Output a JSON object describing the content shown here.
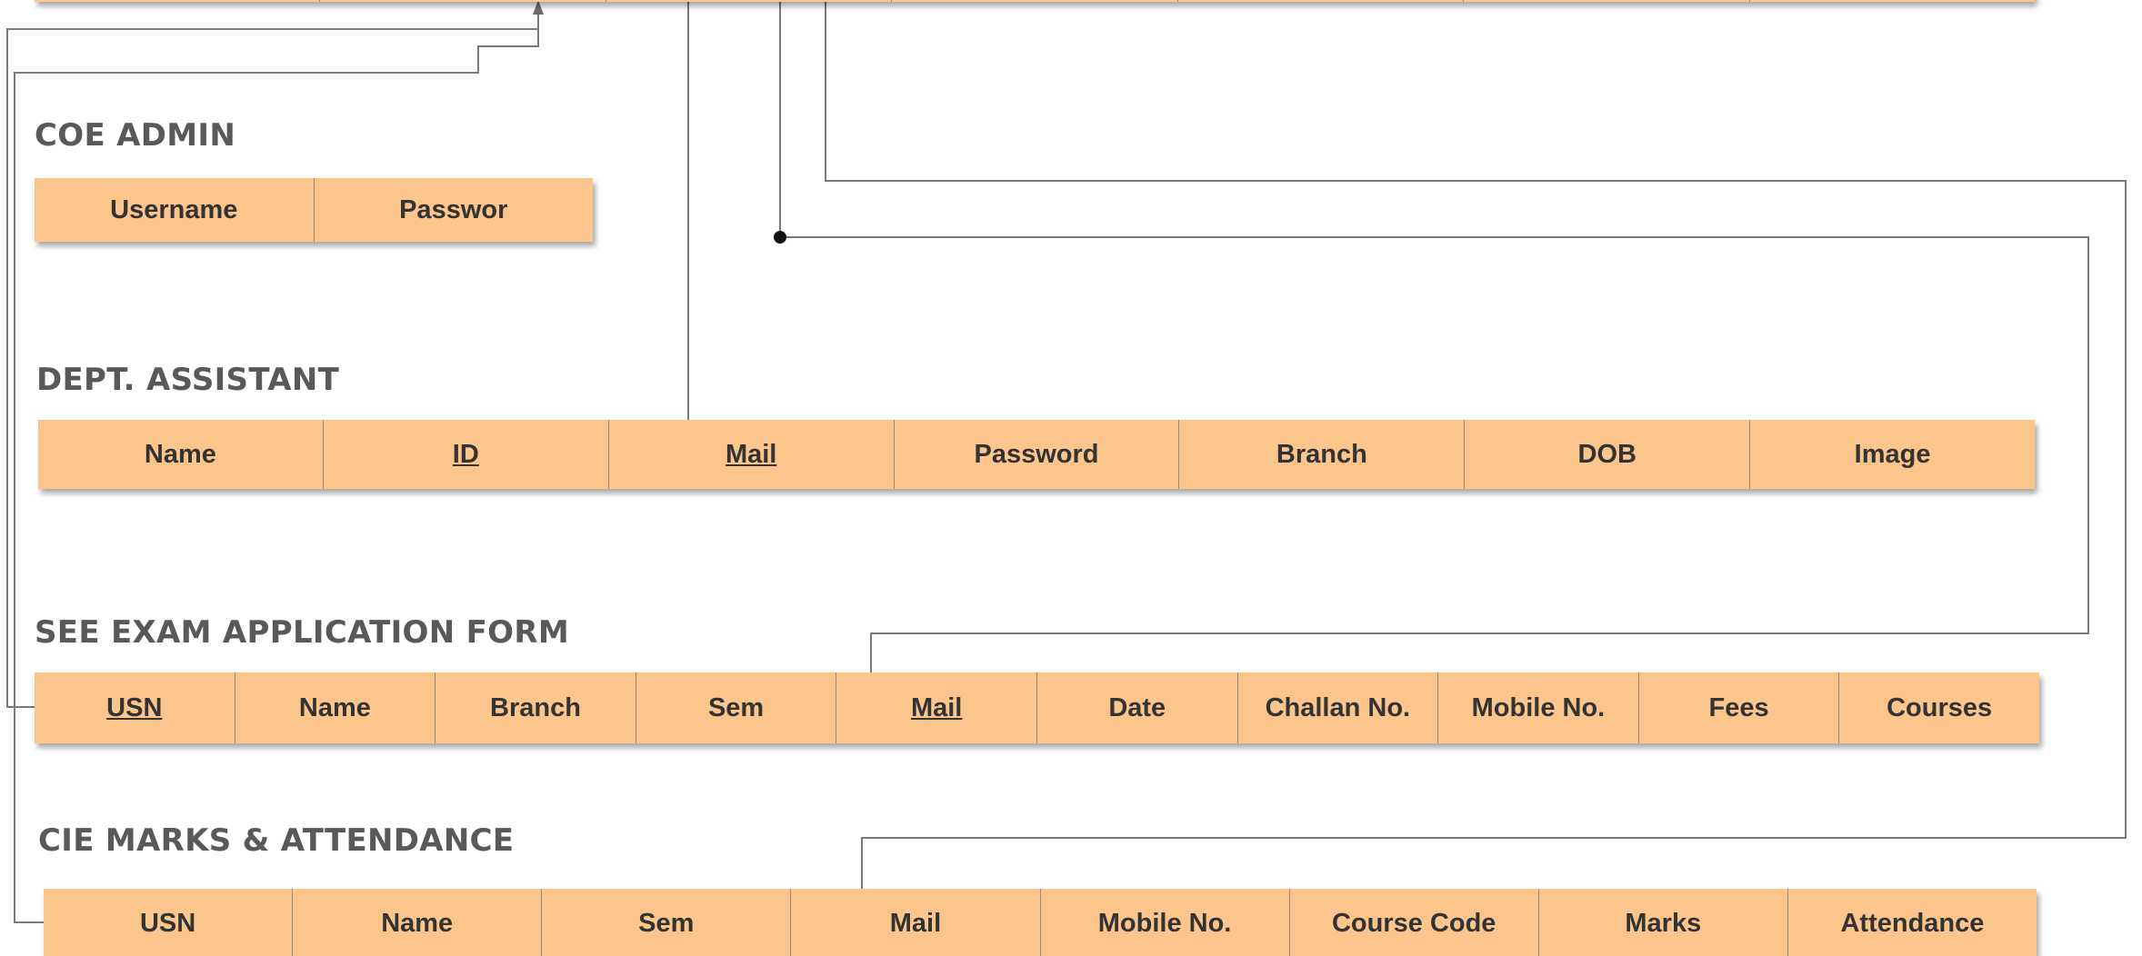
{
  "entities": [
    {
      "title": "",
      "attributes": [
        "",
        "",
        "",
        "",
        "",
        "",
        ""
      ],
      "keys": []
    },
    {
      "title": "COE ADMIN",
      "attributes": [
        "Username",
        "Passwor"
      ],
      "keys": []
    },
    {
      "title": "DEPT. ASSISTANT",
      "attributes": [
        "Name",
        "ID",
        "Mail",
        "Password",
        "Branch",
        "DOB",
        "Image"
      ],
      "keys": [
        1,
        2
      ]
    },
    {
      "title": "SEE EXAM APPLICATION FORM",
      "attributes": [
        "USN",
        "Name",
        "Branch",
        "Sem",
        "Mail",
        "Date",
        "Challan No.",
        "Mobile No.",
        "Fees",
        "Courses"
      ],
      "keys": [
        0,
        4
      ]
    },
    {
      "title": "CIE MARKS & ATTENDANCE",
      "attributes": [
        "USN",
        "Name",
        "Sem",
        "Mail",
        "Mobile No.",
        "Course Code",
        "Marks",
        "Attendance"
      ],
      "keys": []
    }
  ],
  "colors": {
    "table_fill": "#fcc58c",
    "title_text": "#595959",
    "cell_text": "#333333",
    "connector": "#6b6b6b"
  }
}
